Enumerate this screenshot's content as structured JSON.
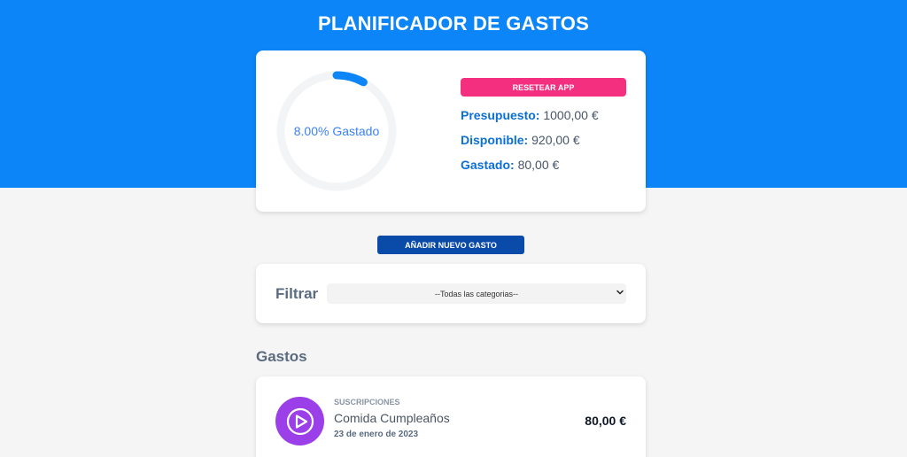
{
  "app": {
    "title": "PLANIFICADOR DE GASTOS",
    "colors": {
      "header": "#0b85f8",
      "accent": "#0b6fd6",
      "reset": "#f52f7f",
      "add": "#0a4aa8",
      "category_subscriptions": "#9b3fe8"
    }
  },
  "budget": {
    "progress_percent": 8,
    "progress_label": "8.00% Gastado",
    "reset_label": "RESETEAR APP",
    "presupuesto_label": "Presupuesto:",
    "presupuesto_value": "1000,00 €",
    "disponible_label": "Disponible:",
    "disponible_value": "920,00 €",
    "gastado_label": "Gastado:",
    "gastado_value": "80,00 €"
  },
  "actions": {
    "add_expense_label": "AÑADIR NUEVO GASTO"
  },
  "filter": {
    "label": "Filtrar",
    "selected": "--Todas las categorias--",
    "icon": "chevron-down-icon"
  },
  "expenses": {
    "section_title": "Gastos",
    "items": [
      {
        "category": "SUSCRIPCIONES",
        "name": "Comida Cumpleaños",
        "date": "23 de enero de 2023",
        "amount": "80,00 €",
        "icon": "play-circle-icon"
      }
    ]
  }
}
